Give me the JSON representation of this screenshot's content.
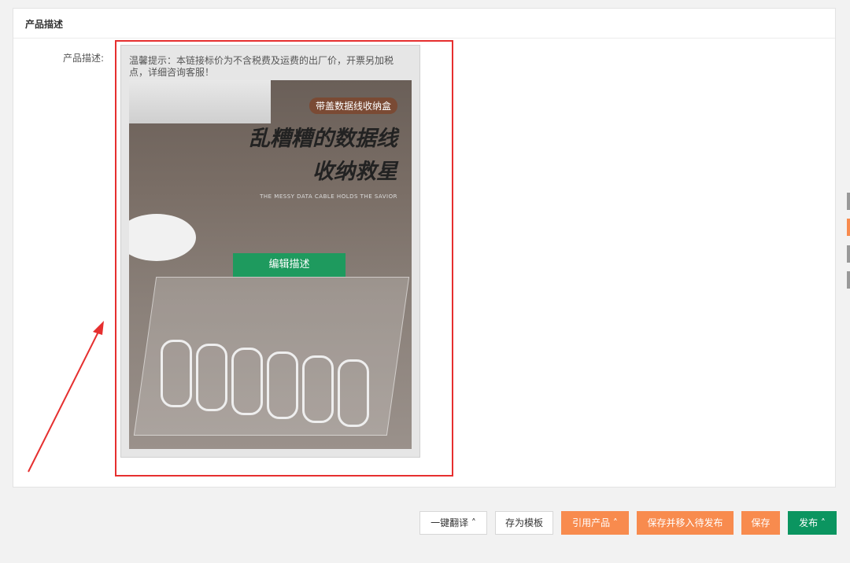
{
  "section": {
    "title": "产品描述"
  },
  "field": {
    "label": "产品描述:"
  },
  "editor": {
    "tip": "温馨提示：本链接标价为不含税费及运费的出厂价，开票另加税点，详细咨询客服！",
    "image": {
      "badge": "带盖数据线收纳盒",
      "headline_line1": "乱糟糟的数据线",
      "headline_line2": "收纳救星",
      "subtitle": "THE MESSY DATA CABLE HOLDS THE SAVIOR"
    },
    "edit_button": "编辑描述"
  },
  "footer": {
    "translate": "一键翻译",
    "save_template": "存为模板",
    "reference_product": "引用产品",
    "save_move": "保存并移入待发布",
    "save": "保存",
    "publish": "发布"
  },
  "colors": {
    "annotation_red": "#e62f2f",
    "primary_green": "#0b9560",
    "accent_orange": "#f88b4e"
  }
}
